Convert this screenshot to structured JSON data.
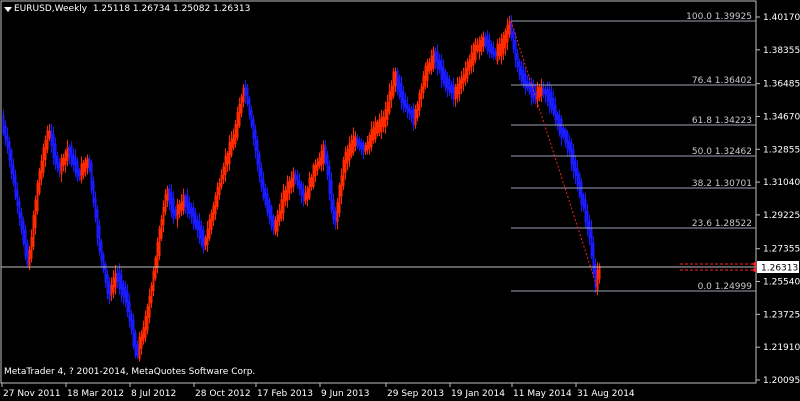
{
  "window": {
    "title_symbol": "EURUSD,Weekly",
    "ohlc": "1.25118 1.26734 1.25082 1.26313",
    "copyright": "MetaTrader 4, ? 2001-2014, MetaQuotes Software Corp."
  },
  "colors": {
    "background": "#000000",
    "frame": "#c0c0c0",
    "bull_candle": "#ff2a00",
    "bear_candle": "#1a1aff",
    "fib_line": "#9aa4b0",
    "trend_line": "#ff2020",
    "bid_line": "#c0c0c0",
    "text": "#ffffff"
  },
  "y_axis": {
    "labels": [
      "1.40170",
      "1.38355",
      "1.36485",
      "1.34670",
      "1.32855",
      "1.31040",
      "1.29225",
      "1.27355",
      "1.25540",
      "1.23725",
      "1.21910",
      "1.20095"
    ],
    "current_price": "1.26313"
  },
  "x_axis": {
    "labels": [
      "27 Nov 2011",
      "18 Mar 2012",
      "8 Jul 2012",
      "28 Oct 2012",
      "17 Feb 2013",
      "9 Jun 2013",
      "29 Sep 2013",
      "19 Jan 2014",
      "11 May 2014",
      "31 Aug 2014"
    ]
  },
  "fibonacci": [
    {
      "level": "100.0",
      "price": "1.39925"
    },
    {
      "level": "76.4",
      "price": "1.36402"
    },
    {
      "level": "61.8",
      "price": "1.34223"
    },
    {
      "level": "50.0",
      "price": "1.32462"
    },
    {
      "level": "38.2",
      "price": "1.30701"
    },
    {
      "level": "23.6",
      "price": "1.28522"
    },
    {
      "level": "0.0",
      "price": "1.24999"
    }
  ]
}
